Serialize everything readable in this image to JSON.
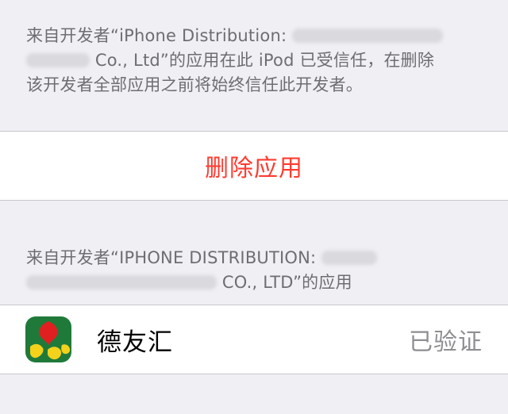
{
  "trust_section": {
    "line1_prefix": "来自开发者“iPhone Distribution:",
    "line2_suffix": "Co., Ltd”的应用在此 iPod 已受信任，在删除",
    "line3": "该开发者全部应用之前将始终信任此开发者。"
  },
  "delete_button": {
    "label": "删除应用"
  },
  "apps_section": {
    "line1_prefix": "来自开发者“IPHONE DISTRIBUTION:",
    "line2_suffix": "CO., LTD”的应用"
  },
  "app_row": {
    "name": "德友汇",
    "status": "已验证",
    "icon": "app-icon"
  },
  "colors": {
    "background": "#efeff4",
    "destructive": "#ff3b30",
    "secondary_text": "#6d6d72",
    "status_text": "#8e8e93",
    "icon_green": "#1f7a3a",
    "icon_red": "#e02020",
    "icon_yellow": "#f2d21b"
  }
}
